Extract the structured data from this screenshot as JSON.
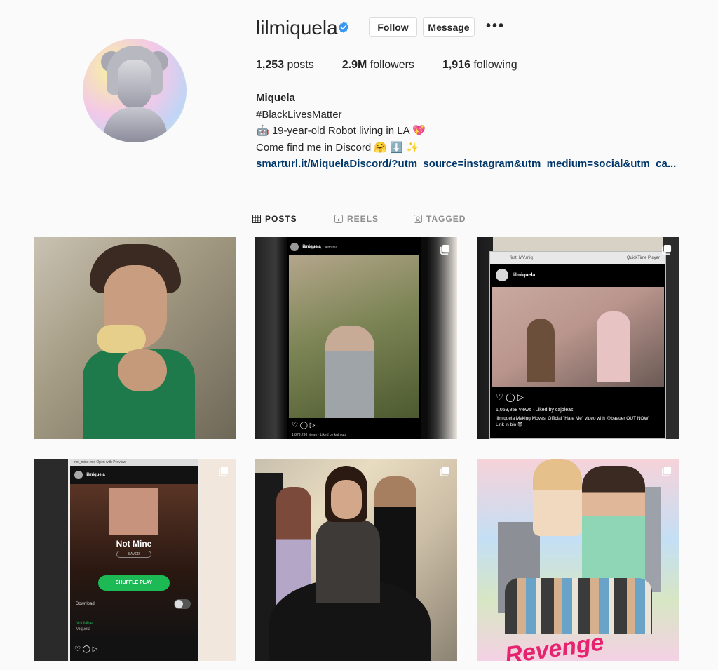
{
  "profile": {
    "username": "lilmiquela",
    "follow_label": "Follow",
    "message_label": "Message",
    "more_label": "•••",
    "stats": {
      "posts_count": "1,253",
      "posts_label": "posts",
      "followers_count": "2.9M",
      "followers_label": "followers",
      "following_count": "1,916",
      "following_label": "following"
    },
    "bio": {
      "name": "Miquela",
      "line1": "#BlackLivesMatter",
      "line2": "🤖 19-year-old Robot living in LA 💖",
      "line3": "Come find me in Discord 🤗 ⬇️ ✨",
      "link": "smarturl.it/MiquelaDiscord/?utm_source=instagram&utm_medium=social&utm_ca..."
    }
  },
  "tabs": [
    {
      "label": "POSTS",
      "icon": "grid-icon",
      "active": true
    },
    {
      "label": "REELS",
      "icon": "reels-icon",
      "active": false
    },
    {
      "label": "TAGGED",
      "icon": "tagged-icon",
      "active": false
    }
  ],
  "posts": {
    "p2": {
      "user": "lilmiquela",
      "location": "Los Angeles, California",
      "views": "1,879,298 views · Liked by kutmup"
    },
    "p3": {
      "window_title": "first_MV.miq",
      "window_app": "QuickTime Player",
      "user": "lilmiquela",
      "views": "1,059,858 views · Liked by cajoleas",
      "caption": "lilmiquela Making Moves. Official \"Hate Me\" video with @baauer OUT NOW! Link in bio 😈"
    },
    "p4": {
      "window_title": "not_mine.miq",
      "window_app": "Open with Preview",
      "user": "lilmiquela",
      "song": "Not Mine",
      "saved": "SAVED",
      "shuffle": "SHUFFLE PLAY",
      "download": "Download",
      "track": "Not Mine",
      "artist": "Miquela"
    },
    "p6": {
      "title": "Revenge"
    }
  },
  "colors": {
    "link": "#00376b",
    "verified": "#3897f0",
    "spotify": "#1db954"
  }
}
